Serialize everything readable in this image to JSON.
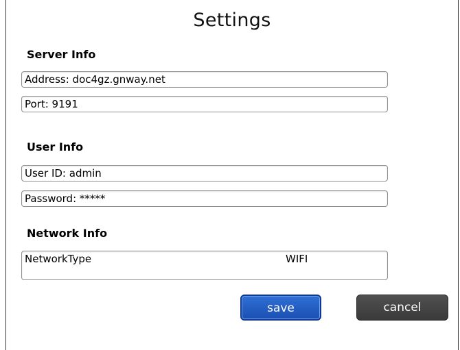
{
  "title": "Settings",
  "server_info": {
    "heading": "Server Info",
    "address": "Address: doc4gz.gnway.net",
    "port": "Port: 9191"
  },
  "user_info": {
    "heading": "User Info",
    "user_id": "User ID: admin",
    "password": "Password: *****"
  },
  "network_info": {
    "heading": "Network Info",
    "type_label": "NetworkType",
    "type_value": "WIFI"
  },
  "actions": {
    "save_label": "save",
    "cancel_label": "cancel"
  },
  "colors": {
    "save_button": "#1f5cc2",
    "cancel_button": "#444444",
    "field_border": "#8f8f8f"
  }
}
